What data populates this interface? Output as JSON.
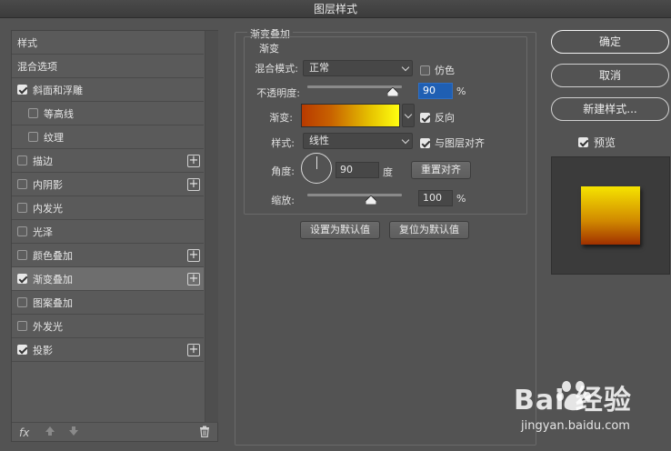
{
  "window": {
    "title": "图层样式"
  },
  "sidebar": {
    "items": [
      {
        "label": "样式",
        "checkbox": false,
        "checked": false,
        "indent": false,
        "plus": false,
        "selected": false
      },
      {
        "label": "混合选项",
        "checkbox": false,
        "checked": false,
        "indent": false,
        "plus": false,
        "selected": false
      },
      {
        "label": "斜面和浮雕",
        "checkbox": true,
        "checked": true,
        "indent": false,
        "plus": false,
        "selected": false
      },
      {
        "label": "等高线",
        "checkbox": true,
        "checked": false,
        "indent": true,
        "plus": false,
        "selected": false
      },
      {
        "label": "纹理",
        "checkbox": true,
        "checked": false,
        "indent": true,
        "plus": false,
        "selected": false
      },
      {
        "label": "描边",
        "checkbox": true,
        "checked": false,
        "indent": false,
        "plus": true,
        "selected": false
      },
      {
        "label": "内阴影",
        "checkbox": true,
        "checked": false,
        "indent": false,
        "plus": true,
        "selected": false
      },
      {
        "label": "内发光",
        "checkbox": true,
        "checked": false,
        "indent": false,
        "plus": false,
        "selected": false
      },
      {
        "label": "光泽",
        "checkbox": true,
        "checked": false,
        "indent": false,
        "plus": false,
        "selected": false
      },
      {
        "label": "颜色叠加",
        "checkbox": true,
        "checked": false,
        "indent": false,
        "plus": true,
        "selected": false
      },
      {
        "label": "渐变叠加",
        "checkbox": true,
        "checked": true,
        "indent": false,
        "plus": true,
        "selected": true
      },
      {
        "label": "图案叠加",
        "checkbox": true,
        "checked": false,
        "indent": false,
        "plus": false,
        "selected": false
      },
      {
        "label": "外发光",
        "checkbox": true,
        "checked": false,
        "indent": false,
        "plus": false,
        "selected": false
      },
      {
        "label": "投影",
        "checkbox": true,
        "checked": true,
        "indent": false,
        "plus": true,
        "selected": false
      }
    ],
    "plus_glyph": "+",
    "footer": {
      "fx_label": "fx",
      "up_icon": "arrow-up-icon",
      "down_icon": "arrow-down-icon",
      "trash_icon": "trash-icon"
    }
  },
  "gradient_overlay": {
    "section_title": "渐变叠加",
    "group_title": "渐变",
    "blend_mode_label": "混合模式:",
    "blend_mode_value": "正常",
    "dither_label": "仿色",
    "dither_checked": false,
    "opacity_label": "不透明度:",
    "opacity_value": "90",
    "opacity_unit": "%",
    "opacity_level": 0.9,
    "gradient_label": "渐变:",
    "gradient_colors": [
      "#b83a00",
      "#ffff10"
    ],
    "reverse_label": "反向",
    "reverse_checked": true,
    "style_label": "样式:",
    "style_value": "线性",
    "align_label": "与图层对齐",
    "align_checked": true,
    "angle_label": "角度:",
    "angle_value": "90",
    "angle_unit": "度",
    "reset_align_button": "重置对齐",
    "scale_label": "缩放:",
    "scale_value": "100",
    "scale_unit": "%",
    "scale_level": 0.67,
    "set_default_button": "设置为默认值",
    "reset_default_button": "复位为默认值"
  },
  "actions": {
    "ok": "确定",
    "cancel": "取消",
    "new_style": "新建样式...",
    "preview_label": "预览",
    "preview_checked": true
  },
  "watermark": {
    "brand": "Bai 经验",
    "url": "jingyan.baidu.com"
  }
}
